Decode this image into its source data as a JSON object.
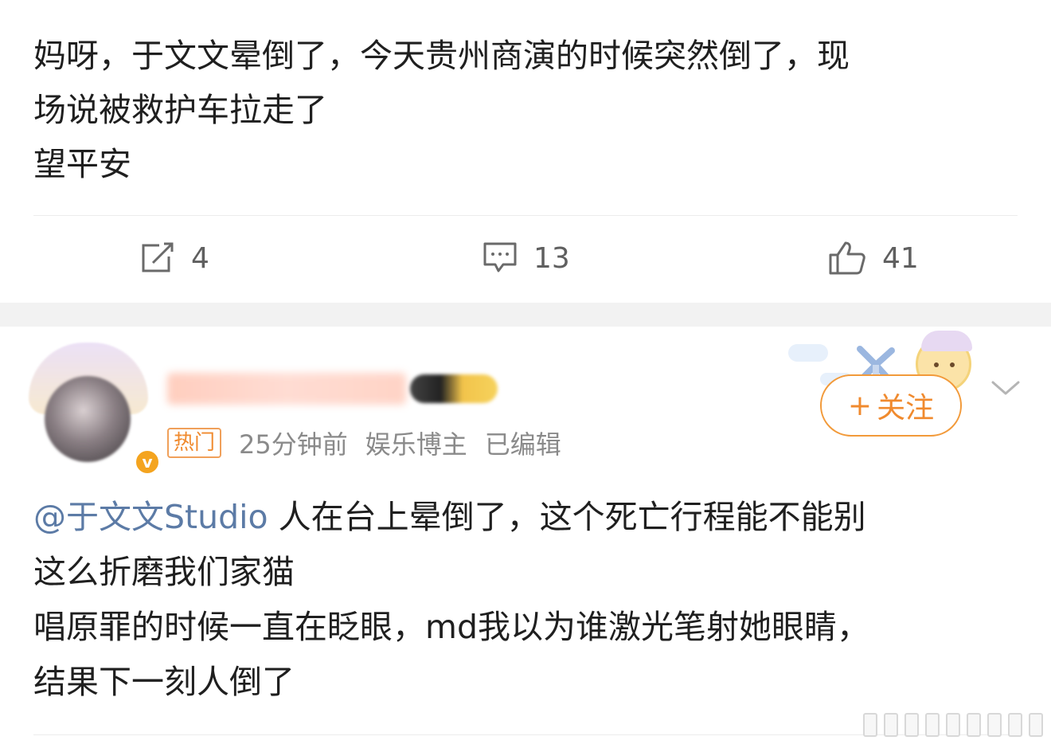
{
  "post1": {
    "lines": [
      "妈呀，于文文晕倒了，今天贵州商演的时候突然倒了，现",
      "场说被救护车拉走了",
      "望平安"
    ]
  },
  "actions": {
    "repost_count": "4",
    "comment_count": "13",
    "like_count": "41"
  },
  "post2": {
    "user": {
      "verified_badge": "v"
    },
    "meta": {
      "hot_tag": "热门",
      "time": "25分钟前",
      "category": "娱乐博主",
      "edited": "已编辑"
    },
    "follow_button": {
      "icon": "+",
      "label": "关注"
    },
    "body": {
      "mention": "@于文文Studio",
      "line1_rest": " 人在台上晕倒了，这个死亡行程能不能别",
      "line2": "这么折磨我们家猫",
      "line3": "唱原罪的时候一直在眨眼，md我以为谁激光笔射她眼睛，",
      "line4": "结果下一刻人倒了"
    }
  },
  "colors": {
    "accent": "#f08a2e",
    "mention": "#5c7ba6",
    "meta_gray": "#8a8a8a",
    "separator": "#f2f2f2"
  }
}
